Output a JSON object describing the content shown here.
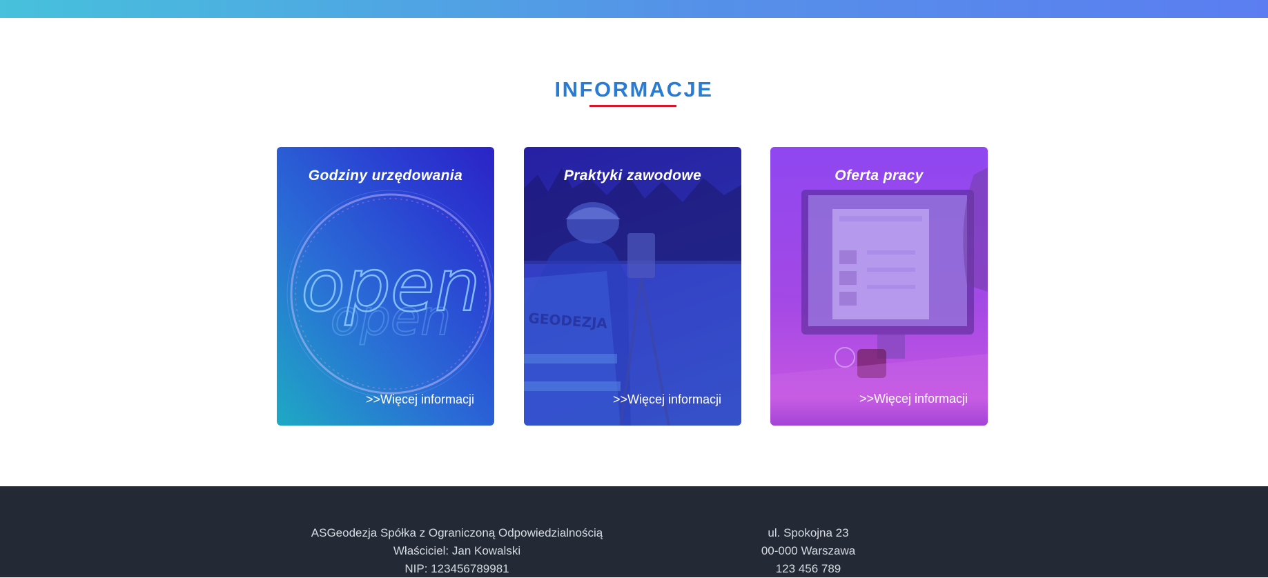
{
  "section": {
    "title": "INFORMACJE"
  },
  "cards": [
    {
      "title": "Godziny urzędowania",
      "link": ">>Więcej informacji",
      "image": "open-sign",
      "sign_text": "open"
    },
    {
      "title": "Praktyki zawodowe",
      "link": ">>Więcej informacji",
      "image": "surveyor-photo",
      "vest_text": "GEODEZJA"
    },
    {
      "title": "Oferta pracy",
      "link": ">>Więcej informacji",
      "image": "office-desk-photo"
    }
  ],
  "footer": {
    "company": "ASGeodezja Spółka z Ograniczoną Odpowiedzialnością",
    "owner": "Właściciel: Jan Kowalski",
    "nip": "NIP: 123456789981",
    "street": "ul. Spokojna 23",
    "city": "00-000 Warszawa",
    "phone": "123 456 789"
  },
  "colors": {
    "title_blue": "#2a7bd4",
    "underline_red": "#d5172d",
    "footer_bg": "#232a36"
  }
}
